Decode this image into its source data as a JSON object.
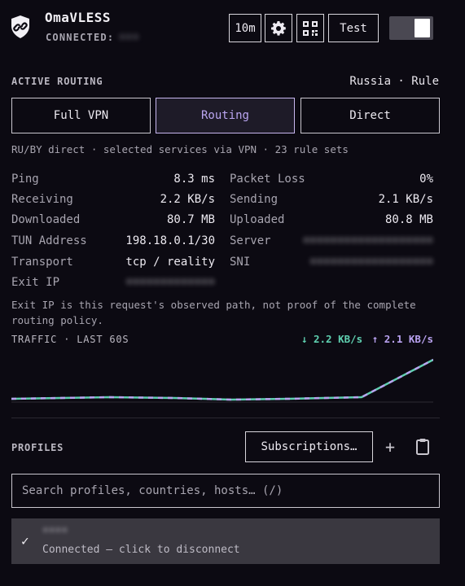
{
  "header": {
    "app_name": "OmaVLESS",
    "status_label": "CONNECTED:",
    "status_value_redacted": "•••",
    "timer_label": "10m",
    "test_label": "Test",
    "icons": {
      "logo": "shield-link-icon",
      "settings": "gear-icon",
      "qr": "qr-code-icon"
    },
    "toggle_on": true
  },
  "routing": {
    "section_label": "ACTIVE ROUTING",
    "region": "Russia · Rule",
    "modes": [
      "Full VPN",
      "Routing",
      "Direct"
    ],
    "selected_mode": "Routing",
    "description": "RU/BY direct · selected services via VPN · 23 rule sets"
  },
  "stats": {
    "ping": {
      "label": "Ping",
      "value": "8.3 ms"
    },
    "packet_loss": {
      "label": "Packet Loss",
      "value": "0%"
    },
    "receiving": {
      "label": "Receiving",
      "value": "2.2 KB/s"
    },
    "sending": {
      "label": "Sending",
      "value": "2.1 KB/s"
    },
    "downloaded": {
      "label": "Downloaded",
      "value": "80.7 MB"
    },
    "uploaded": {
      "label": "Uploaded",
      "value": "80.8 MB"
    },
    "tun": {
      "label": "TUN Address",
      "value": "198.18.0.1/30"
    },
    "server": {
      "label": "Server",
      "value": "•••••••••••••••••••"
    },
    "transport": {
      "label": "Transport",
      "value": "tcp / reality"
    },
    "sni": {
      "label": "SNI",
      "value": "••••••••••••••••••"
    },
    "exit_ip": {
      "label": "Exit IP",
      "value": "•••••••••••••"
    },
    "note": "Exit IP is this request's observed path, not proof of the complete routing policy."
  },
  "traffic": {
    "label": "TRAFFIC · LAST 60S",
    "down_rate": "↓ 2.2 KB/s",
    "up_rate": "↑ 2.1 KB/s",
    "colors": {
      "down": "#5fd0b0",
      "up": "#b9a2f0"
    }
  },
  "profiles": {
    "section_label": "PROFILES",
    "subscriptions_label": "Subscriptions…",
    "add_label": "+",
    "icons": {
      "paste": "clipboard-icon",
      "selected": "check-icon"
    },
    "search_placeholder": "Search profiles, countries, hosts…  (/)",
    "items": [
      {
        "name": "••••",
        "status": "Connected — click to disconnect",
        "selected": true
      }
    ]
  }
}
